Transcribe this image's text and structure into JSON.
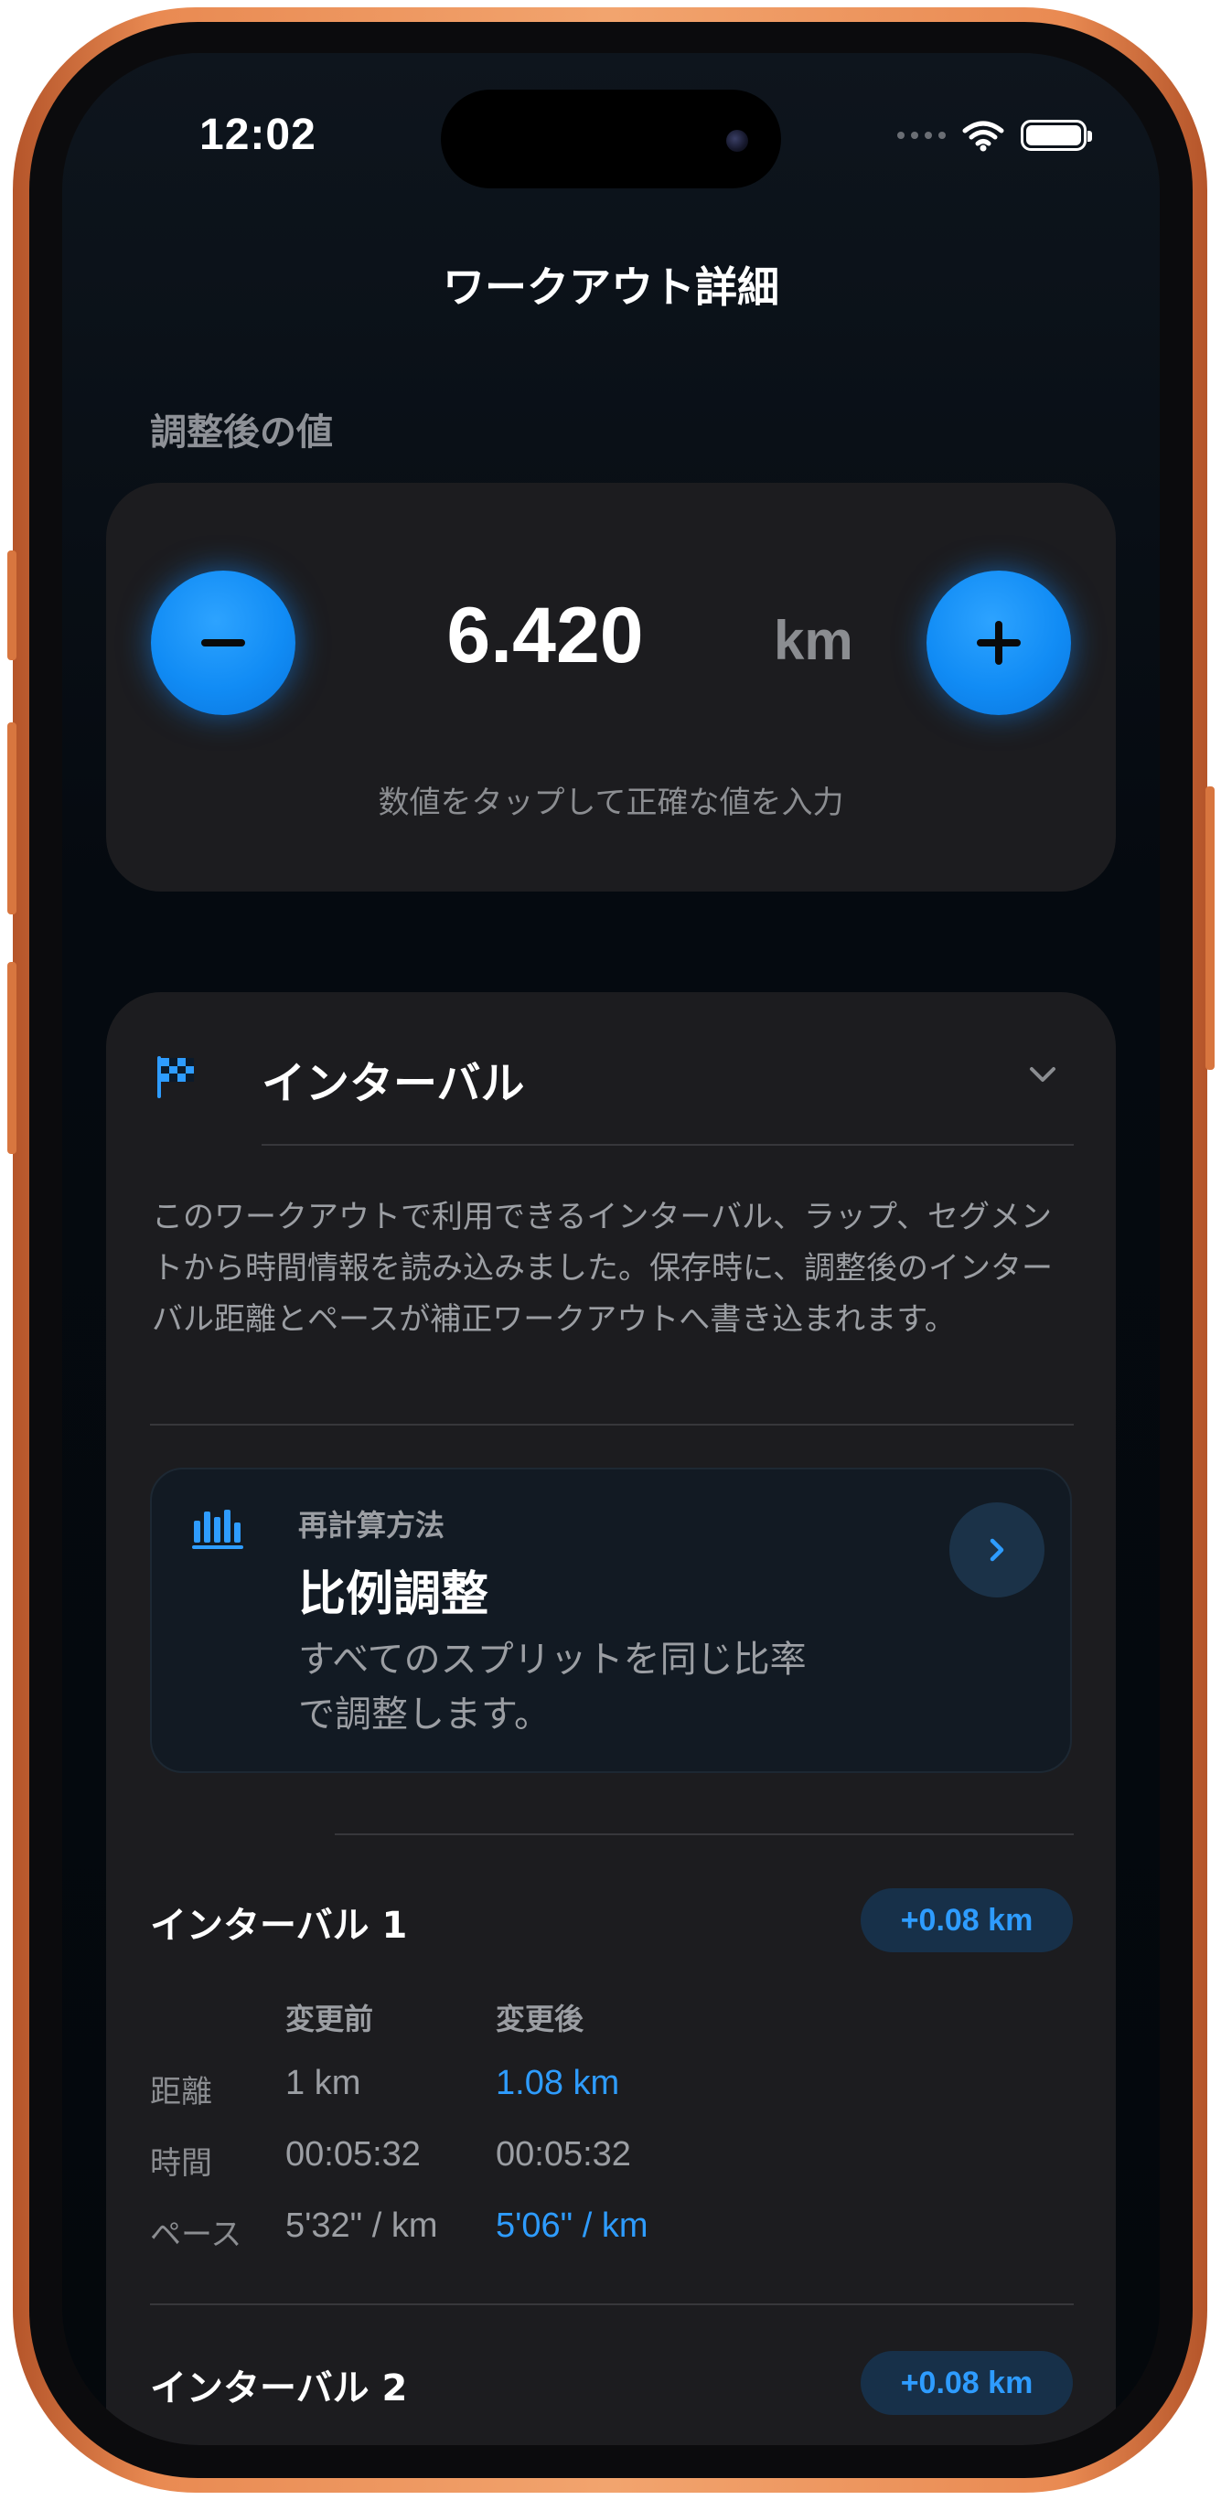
{
  "status_bar": {
    "time": "12:02"
  },
  "nav": {
    "title": "ワークアウト詳細"
  },
  "adjusted": {
    "section_label": "調整後の値",
    "value": "6.420",
    "unit": "km",
    "hint": "数値をタップして正確な値を入力"
  },
  "intervals": {
    "title": "インターバル",
    "description": "このワークアウトで利用できるインターバル、ラップ、セグメントから時間情報を読み込みました。保存時に、調整後のインターバル距離とペースが補正ワークアウトへ書き込まれます。",
    "method": {
      "label": "再計算方法",
      "name": "比例調整",
      "description": "すべてのスプリットを同じ比率で調整します。"
    },
    "items": [
      {
        "name": "インターバル 1",
        "badge": "+0.08 km",
        "col_before": "変更前",
        "col_after": "変更後",
        "rows": [
          {
            "label": "距離",
            "before": "1 km",
            "after": "1.08 km"
          },
          {
            "label": "時間",
            "before": "00:05:32",
            "after": "00:05:32"
          },
          {
            "label": "ペース",
            "before": "5'32\" / km",
            "after": "5'06\" / km"
          }
        ]
      },
      {
        "name": "インターバル 2",
        "badge": "+0.08 km"
      }
    ]
  },
  "colors": {
    "accent": "#1a8cff",
    "frame": "#e98a52",
    "card": "#1c1c1f",
    "screen_bg": "#05090e"
  },
  "icons": {
    "minus": "minus-icon",
    "plus": "plus-icon",
    "flag": "checkered-flag-icon",
    "chevron": "chevron-down-icon",
    "chart": "bar-chart-icon",
    "arrow": "chevron-right-icon"
  }
}
